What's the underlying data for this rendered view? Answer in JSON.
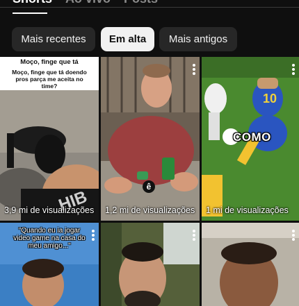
{
  "tabs": [
    {
      "label": "Shorts"
    },
    {
      "label": "Ao vivo"
    },
    {
      "label": "Posts"
    }
  ],
  "chips": [
    {
      "label": "Mais recentes",
      "selected": false
    },
    {
      "label": "Em alta",
      "selected": true
    },
    {
      "label": "Mais antigos",
      "selected": false
    }
  ],
  "shorts": [
    {
      "caption_title": "Moço, finge que tá",
      "caption_text": "Moço, finge que tá doendo pros parça me aceita no time?",
      "views": "3,9 mi de visualizações"
    },
    {
      "overlay_badge": "ê",
      "views": "1,2 mi de visualizações"
    },
    {
      "overlay_text": "COMO",
      "views": "1 mi de visualizações"
    },
    {
      "overlay_text": "\"Quando eu ia jogar video game na casa do meu amigo...\""
    },
    {},
    {}
  ],
  "colors": {
    "background": "#0f0f0f",
    "chip": "#272727",
    "chip_selected": "#f1f1f1"
  },
  "icons": [
    "more-vert-icon"
  ]
}
